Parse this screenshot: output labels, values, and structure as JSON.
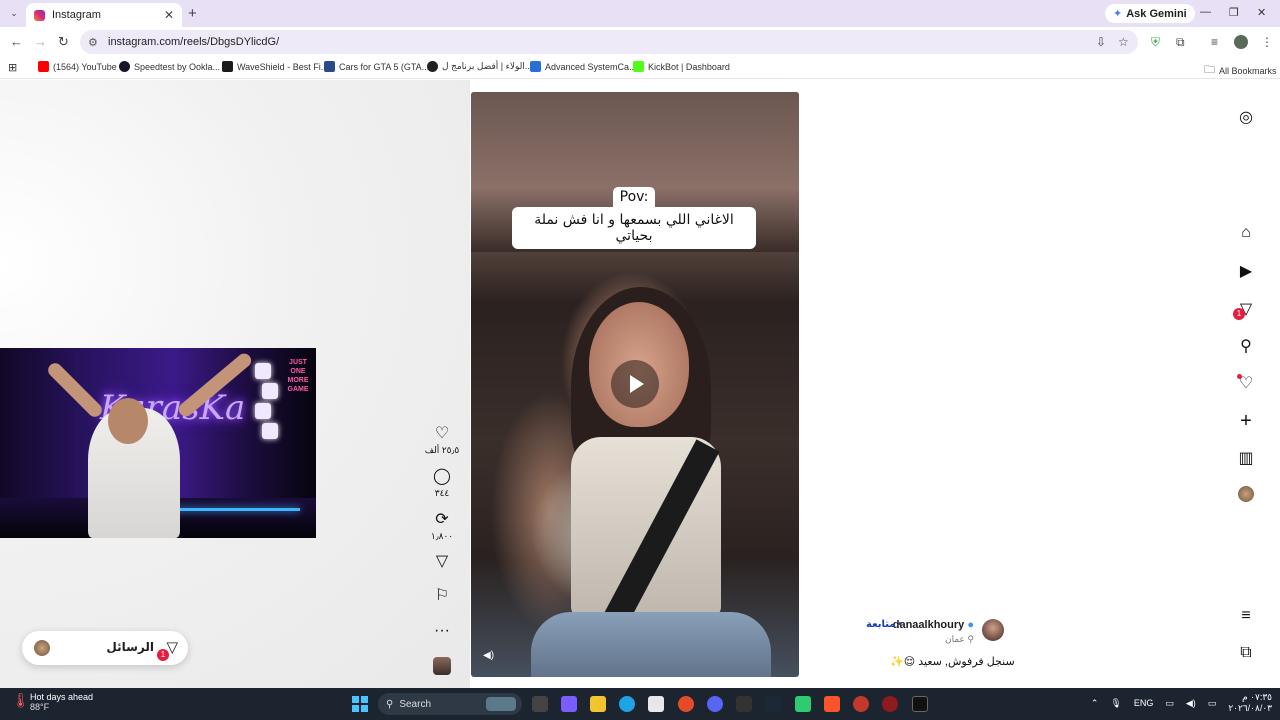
{
  "browser": {
    "tab_title": "Instagram",
    "new_tab": "+",
    "close": "✕",
    "gemini": "Ask Gemini",
    "url": "instagram.com/reels/DbgsDYlicdG/",
    "window_controls": [
      "—",
      "❐",
      "✕"
    ]
  },
  "bookmarks": [
    {
      "label": "(1564) YouTube",
      "color": "#ff0000"
    },
    {
      "label": "Speedtest by Ookla...",
      "color": "#141526"
    },
    {
      "label": "WaveShield - Best Fi...",
      "color": "#1b1b1b"
    },
    {
      "label": "Cars for GTA 5 (GTA...",
      "color": "#2b4a8c"
    },
    {
      "label": "الولاء | أفضل برنامج ل...",
      "color": "#222222"
    },
    {
      "label": "Advanced SystemCa...",
      "color": "#2a6fd6"
    },
    {
      "label": "KickBot | Dashboard",
      "color": "#53fc18"
    }
  ],
  "all_bookmarks": "All Bookmarks",
  "reel": {
    "caption_pov": "Pov:",
    "caption_line": "الاغاني اللي بسمعها و انا فش نملة بحياتي",
    "likes": "٢٥٫٥ ألف",
    "comments": "٣٤٤",
    "reposts": "١٫٨٠٠"
  },
  "author": {
    "name": "danaalkhoury",
    "follow": "متابعة",
    "location": "عمان",
    "post_caption": "سنجل فرفوش, سعيد 😌✨"
  },
  "rail": {
    "messages_badge": "1"
  },
  "messages_pill": {
    "label": "الرسائل",
    "badge": "1"
  },
  "webcam": {
    "neon_text": "KarasKa",
    "poster_text": "JUST ONE MORE GAME"
  },
  "taskbar": {
    "weather_title": "Hot days ahead",
    "weather_temp": "88°F",
    "search_placeholder": "Search",
    "lang": "ENG",
    "time": "٠٧:٣٥ م",
    "date": "٢٠٢٦/٠٨/٠٣"
  }
}
